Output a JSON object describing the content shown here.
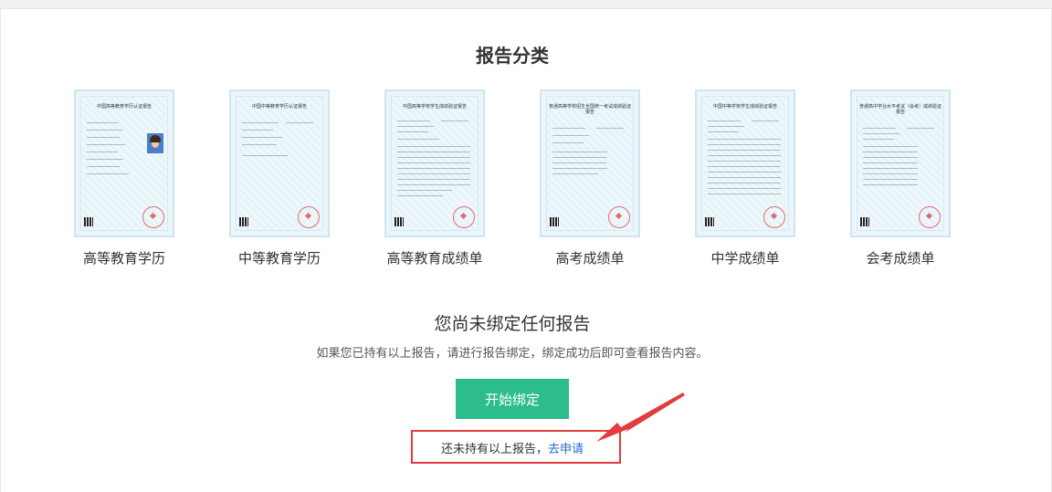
{
  "page_title": "报告分类",
  "categories": [
    {
      "label": "高等教育学历",
      "cert_title": "中国高等教育学历认证报告"
    },
    {
      "label": "中等教育学历",
      "cert_title": "中国中等教育学历认证报告"
    },
    {
      "label": "高等教育成绩单",
      "cert_title": "中国高等学校学生成绩验证报告"
    },
    {
      "label": "高考成绩单",
      "cert_title": "普通高等学校招生全国统一考试成绩验证报告"
    },
    {
      "label": "中学成绩单",
      "cert_title": "中国中等学校学生成绩验证报告"
    },
    {
      "label": "会考成绩单",
      "cert_title": "普通高中学业水平考试（会考）成绩验证报告"
    }
  ],
  "empty_state": {
    "title": "您尚未绑定任何报告",
    "description": "如果您已持有以上报告，请进行报告绑定，绑定成功后即可查看报告内容。",
    "bind_button_label": "开始绑定",
    "no_report_text": "还未持有以上报告，",
    "apply_link_label": "去申请"
  },
  "colors": {
    "accent_green": "#2cbd8a",
    "link_blue": "#1f6fc5",
    "highlight_red": "#e23c3c"
  }
}
